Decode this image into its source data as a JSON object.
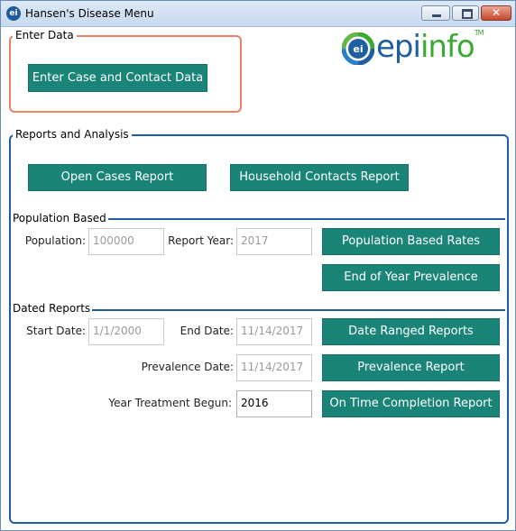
{
  "window": {
    "title": "Hansen's Disease Menu",
    "icon": "ei"
  },
  "logo": {
    "part1": "epi",
    "part2": "info",
    "tm": "TM",
    "badge": "ei",
    "color_epi": "#1f5fa0",
    "color_info": "#3aaa35"
  },
  "enter_data": {
    "legend": "Enter Data",
    "button": "Enter Case and Contact Data"
  },
  "reports": {
    "legend": "Reports and Analysis",
    "open_cases": "Open Cases Report",
    "household_contacts": "Household Contacts Report",
    "population_based": {
      "section": "Population Based",
      "population_label": "Population:",
      "population_value": "100000",
      "report_year_label": "Report Year:",
      "report_year_value": "2017",
      "rates_button": "Population Based Rates",
      "prevalence_button": "End of Year Prevalence"
    },
    "dated_reports": {
      "section": "Dated Reports",
      "start_label": "Start Date:",
      "start_value": "1/1/2000",
      "end_label": "End Date:",
      "end_value": "11/14/2017",
      "ranged_button": "Date Ranged Reports",
      "prevalence_date_label": "Prevalence Date:",
      "prevalence_date_value": "11/14/2017",
      "prevalence_button": "Prevalence Report",
      "year_treatment_label": "Year Treatment Begun:",
      "year_treatment_value": "2016",
      "completion_button": "On Time Completion Report"
    }
  }
}
